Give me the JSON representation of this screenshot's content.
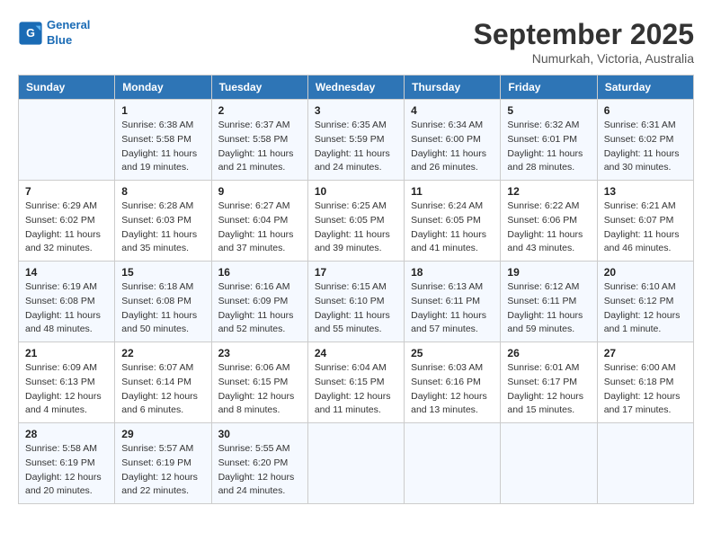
{
  "header": {
    "logo_line1": "General",
    "logo_line2": "Blue",
    "month": "September 2025",
    "location": "Numurkah, Victoria, Australia"
  },
  "days_of_week": [
    "Sunday",
    "Monday",
    "Tuesday",
    "Wednesday",
    "Thursday",
    "Friday",
    "Saturday"
  ],
  "weeks": [
    [
      {
        "day": "",
        "info": ""
      },
      {
        "day": "1",
        "info": "Sunrise: 6:38 AM\nSunset: 5:58 PM\nDaylight: 11 hours\nand 19 minutes."
      },
      {
        "day": "2",
        "info": "Sunrise: 6:37 AM\nSunset: 5:58 PM\nDaylight: 11 hours\nand 21 minutes."
      },
      {
        "day": "3",
        "info": "Sunrise: 6:35 AM\nSunset: 5:59 PM\nDaylight: 11 hours\nand 24 minutes."
      },
      {
        "day": "4",
        "info": "Sunrise: 6:34 AM\nSunset: 6:00 PM\nDaylight: 11 hours\nand 26 minutes."
      },
      {
        "day": "5",
        "info": "Sunrise: 6:32 AM\nSunset: 6:01 PM\nDaylight: 11 hours\nand 28 minutes."
      },
      {
        "day": "6",
        "info": "Sunrise: 6:31 AM\nSunset: 6:02 PM\nDaylight: 11 hours\nand 30 minutes."
      }
    ],
    [
      {
        "day": "7",
        "info": "Sunrise: 6:29 AM\nSunset: 6:02 PM\nDaylight: 11 hours\nand 32 minutes."
      },
      {
        "day": "8",
        "info": "Sunrise: 6:28 AM\nSunset: 6:03 PM\nDaylight: 11 hours\nand 35 minutes."
      },
      {
        "day": "9",
        "info": "Sunrise: 6:27 AM\nSunset: 6:04 PM\nDaylight: 11 hours\nand 37 minutes."
      },
      {
        "day": "10",
        "info": "Sunrise: 6:25 AM\nSunset: 6:05 PM\nDaylight: 11 hours\nand 39 minutes."
      },
      {
        "day": "11",
        "info": "Sunrise: 6:24 AM\nSunset: 6:05 PM\nDaylight: 11 hours\nand 41 minutes."
      },
      {
        "day": "12",
        "info": "Sunrise: 6:22 AM\nSunset: 6:06 PM\nDaylight: 11 hours\nand 43 minutes."
      },
      {
        "day": "13",
        "info": "Sunrise: 6:21 AM\nSunset: 6:07 PM\nDaylight: 11 hours\nand 46 minutes."
      }
    ],
    [
      {
        "day": "14",
        "info": "Sunrise: 6:19 AM\nSunset: 6:08 PM\nDaylight: 11 hours\nand 48 minutes."
      },
      {
        "day": "15",
        "info": "Sunrise: 6:18 AM\nSunset: 6:08 PM\nDaylight: 11 hours\nand 50 minutes."
      },
      {
        "day": "16",
        "info": "Sunrise: 6:16 AM\nSunset: 6:09 PM\nDaylight: 11 hours\nand 52 minutes."
      },
      {
        "day": "17",
        "info": "Sunrise: 6:15 AM\nSunset: 6:10 PM\nDaylight: 11 hours\nand 55 minutes."
      },
      {
        "day": "18",
        "info": "Sunrise: 6:13 AM\nSunset: 6:11 PM\nDaylight: 11 hours\nand 57 minutes."
      },
      {
        "day": "19",
        "info": "Sunrise: 6:12 AM\nSunset: 6:11 PM\nDaylight: 11 hours\nand 59 minutes."
      },
      {
        "day": "20",
        "info": "Sunrise: 6:10 AM\nSunset: 6:12 PM\nDaylight: 12 hours\nand 1 minute."
      }
    ],
    [
      {
        "day": "21",
        "info": "Sunrise: 6:09 AM\nSunset: 6:13 PM\nDaylight: 12 hours\nand 4 minutes."
      },
      {
        "day": "22",
        "info": "Sunrise: 6:07 AM\nSunset: 6:14 PM\nDaylight: 12 hours\nand 6 minutes."
      },
      {
        "day": "23",
        "info": "Sunrise: 6:06 AM\nSunset: 6:15 PM\nDaylight: 12 hours\nand 8 minutes."
      },
      {
        "day": "24",
        "info": "Sunrise: 6:04 AM\nSunset: 6:15 PM\nDaylight: 12 hours\nand 11 minutes."
      },
      {
        "day": "25",
        "info": "Sunrise: 6:03 AM\nSunset: 6:16 PM\nDaylight: 12 hours\nand 13 minutes."
      },
      {
        "day": "26",
        "info": "Sunrise: 6:01 AM\nSunset: 6:17 PM\nDaylight: 12 hours\nand 15 minutes."
      },
      {
        "day": "27",
        "info": "Sunrise: 6:00 AM\nSunset: 6:18 PM\nDaylight: 12 hours\nand 17 minutes."
      }
    ],
    [
      {
        "day": "28",
        "info": "Sunrise: 5:58 AM\nSunset: 6:19 PM\nDaylight: 12 hours\nand 20 minutes."
      },
      {
        "day": "29",
        "info": "Sunrise: 5:57 AM\nSunset: 6:19 PM\nDaylight: 12 hours\nand 22 minutes."
      },
      {
        "day": "30",
        "info": "Sunrise: 5:55 AM\nSunset: 6:20 PM\nDaylight: 12 hours\nand 24 minutes."
      },
      {
        "day": "",
        "info": ""
      },
      {
        "day": "",
        "info": ""
      },
      {
        "day": "",
        "info": ""
      },
      {
        "day": "",
        "info": ""
      }
    ]
  ]
}
